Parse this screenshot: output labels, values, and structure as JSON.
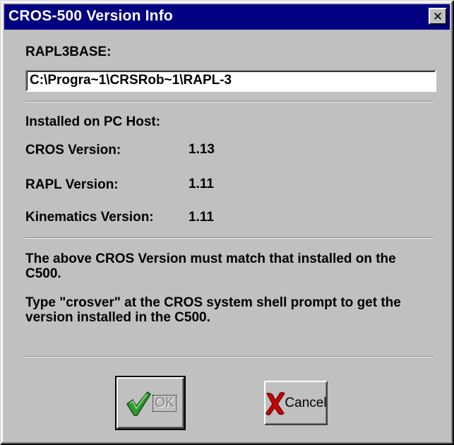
{
  "window": {
    "title": "CROS-500 Version Info",
    "close_symbol": "✕"
  },
  "rapl": {
    "label": "RAPL3BASE:",
    "path_value": "C:\\Progra~1\\CRSRob~1\\RAPL-3"
  },
  "installed": {
    "heading": "Installed on PC Host:",
    "rows": [
      {
        "label": "CROS Version:",
        "value": "1.13"
      },
      {
        "label": "RAPL Version:",
        "value": "1.11"
      },
      {
        "label": "Kinematics Version:",
        "value": "1.11"
      }
    ]
  },
  "notes": {
    "match": "The above CROS Version must match that installed on the C500.",
    "instruction": "Type \"crosver\" at the CROS system shell prompt to get the version installed in the C500."
  },
  "buttons": {
    "ok_label": "OK",
    "cancel_label": "Cancel"
  },
  "icons": {
    "ok_icon": "green-checkmark-icon",
    "cancel_icon": "red-x-icon"
  },
  "colors": {
    "titlebar": "#000080",
    "face": "#c0c0c0",
    "check_green": "#2f9a2f",
    "x_red": "#cc0000"
  }
}
